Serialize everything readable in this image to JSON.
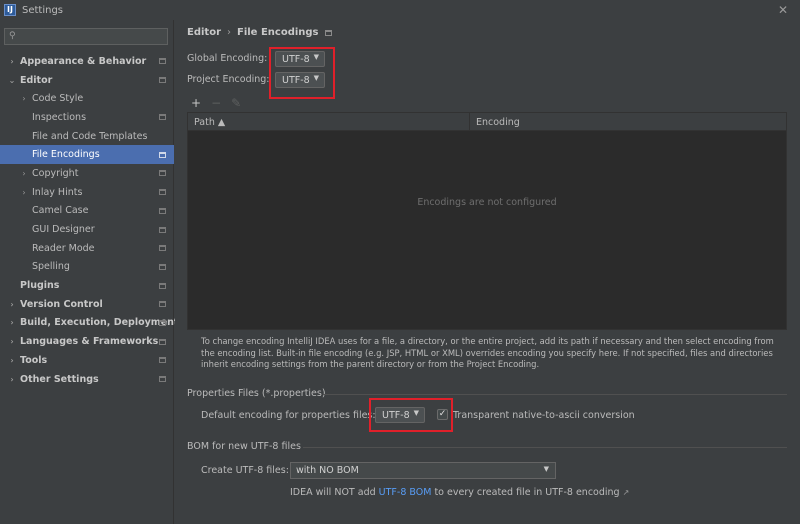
{
  "window": {
    "title": "Settings",
    "icon_text": "IJ",
    "close_glyph": "✕"
  },
  "search": {
    "placeholder": "",
    "icon_glyph": "⚲"
  },
  "tree": [
    {
      "label": "Appearance & Behavior",
      "bold": true,
      "level": 0,
      "arrow": "›",
      "icon": true,
      "selected": false
    },
    {
      "label": "Editor",
      "bold": true,
      "level": 0,
      "arrow": "⌄",
      "icon": true,
      "selected": false
    },
    {
      "label": "Code Style",
      "bold": false,
      "level": 1,
      "arrow": "›",
      "icon": false,
      "selected": false
    },
    {
      "label": "Inspections",
      "bold": false,
      "level": 1,
      "arrow": "",
      "icon": true,
      "selected": false
    },
    {
      "label": "File and Code Templates",
      "bold": false,
      "level": 1,
      "arrow": "",
      "icon": false,
      "selected": false
    },
    {
      "label": "File Encodings",
      "bold": false,
      "level": 1,
      "arrow": "",
      "icon": true,
      "selected": true
    },
    {
      "label": "Copyright",
      "bold": false,
      "level": 1,
      "arrow": "›",
      "icon": true,
      "selected": false
    },
    {
      "label": "Inlay Hints",
      "bold": false,
      "level": 1,
      "arrow": "›",
      "icon": true,
      "selected": false
    },
    {
      "label": "Camel Case",
      "bold": false,
      "level": 1,
      "arrow": "",
      "icon": true,
      "selected": false
    },
    {
      "label": "GUI Designer",
      "bold": false,
      "level": 1,
      "arrow": "",
      "icon": true,
      "selected": false
    },
    {
      "label": "Reader Mode",
      "bold": false,
      "level": 1,
      "arrow": "",
      "icon": true,
      "selected": false
    },
    {
      "label": "Spelling",
      "bold": false,
      "level": 1,
      "arrow": "",
      "icon": true,
      "selected": false
    },
    {
      "label": "Plugins",
      "bold": true,
      "level": 0,
      "arrow": "",
      "icon": true,
      "selected": false
    },
    {
      "label": "Version Control",
      "bold": true,
      "level": 0,
      "arrow": "›",
      "icon": true,
      "selected": false
    },
    {
      "label": "Build, Execution, Deployment",
      "bold": true,
      "level": 0,
      "arrow": "›",
      "icon": true,
      "selected": false
    },
    {
      "label": "Languages & Frameworks",
      "bold": true,
      "level": 0,
      "arrow": "›",
      "icon": true,
      "selected": false
    },
    {
      "label": "Tools",
      "bold": true,
      "level": 0,
      "arrow": "›",
      "icon": true,
      "selected": false
    },
    {
      "label": "Other Settings",
      "bold": true,
      "level": 0,
      "arrow": "›",
      "icon": true,
      "selected": false
    }
  ],
  "breadcrumb": {
    "parent": "Editor",
    "separator": "›",
    "current": "File Encodings"
  },
  "encodings": {
    "global_label": "Global Encoding:",
    "global_value": "UTF-8",
    "project_label": "Project Encoding:",
    "project_value": "UTF-8",
    "dropdown_glyph": "▼"
  },
  "toolbar": {
    "add": "+",
    "remove": "−",
    "edit": "✎"
  },
  "table": {
    "col_path": "Path ▲",
    "col_encoding": "Encoding",
    "empty_text": "Encodings are not configured"
  },
  "description": "To change encoding IntelliJ IDEA uses for a file, a directory, or the entire project, add its path if necessary and then select encoding from the encoding list. Built-in file encoding (e.g. JSP, HTML or XML) overrides encoding you specify here. If not specified, files and directories inherit encoding settings from the parent directory or from the Project Encoding.",
  "properties": {
    "section_title": "Properties Files (*.properties)",
    "default_label": "Default encoding for properties files:",
    "default_value": "UTF-8",
    "transparent_label": "Transparent native-to-ascii conversion",
    "transparent_checked": "✓"
  },
  "bom": {
    "section_title": "BOM for new UTF-8 files",
    "create_label": "Create UTF-8 files:",
    "create_value": "with NO BOM",
    "note_prefix": "IDEA will NOT add",
    "note_link": "UTF-8 BOM",
    "note_suffix": "to every created file in UTF-8 encoding",
    "note_link_icon": "↗"
  },
  "colors": {
    "highlight_box": "#e0202a",
    "selection": "#4b6eaf",
    "link": "#589df6"
  }
}
